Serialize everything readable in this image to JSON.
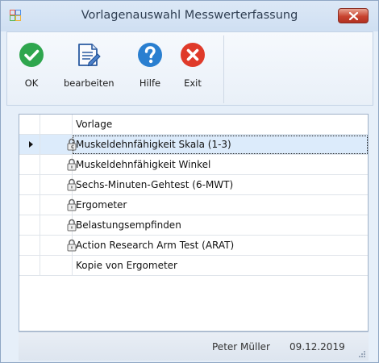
{
  "window": {
    "title": "Vorlagenauswahl Messwerterfassung"
  },
  "toolbar": {
    "ok_label": "OK",
    "edit_label": "bearbeiten",
    "help_label": "Hilfe",
    "exit_label": "Exit"
  },
  "grid": {
    "column_header": "Vorlage",
    "rows": [
      {
        "label": "Muskeldehnfähigkeit Skala (1-3)",
        "locked": true,
        "selected": true
      },
      {
        "label": "Muskeldehnfähigkeit Winkel",
        "locked": true,
        "selected": false
      },
      {
        "label": "Sechs-Minuten-Gehtest (6-MWT)",
        "locked": true,
        "selected": false
      },
      {
        "label": "Ergometer",
        "locked": true,
        "selected": false
      },
      {
        "label": "Belastungsempfinden",
        "locked": true,
        "selected": false
      },
      {
        "label": "Action Research Arm Test (ARAT)",
        "locked": true,
        "selected": false
      },
      {
        "label": "Kopie von Ergometer",
        "locked": false,
        "selected": false
      }
    ]
  },
  "status": {
    "user": "Peter Müller",
    "date": "09.12.2019"
  },
  "colors": {
    "ok_green": "#2fa64e",
    "help_blue": "#2a7fd0",
    "exit_red": "#df3a2a",
    "selection": "#dcebfb"
  },
  "icons": {
    "app": "app-grid-icon",
    "close": "close-icon",
    "ok": "checkmark-icon",
    "edit": "document-edit-icon",
    "help": "question-icon",
    "exit": "x-circle-icon",
    "lock": "padlock-icon",
    "row_pointer": "row-pointer-icon"
  }
}
